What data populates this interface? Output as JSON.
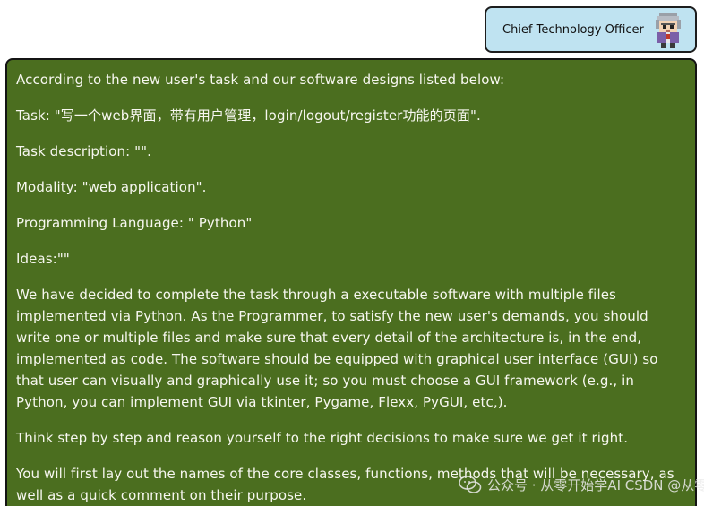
{
  "role": {
    "name": "Chief Technology Officer",
    "avatar_icon": "pixel-robot-avatar-icon"
  },
  "message": {
    "paragraphs": [
      "According to the new user's task and our software designs listed below:",
      "Task: \"写一个web界面，带有用户管理，login/logout/register功能的页面\".",
      "Task description: \"\".",
      "Modality: \"web application\".",
      "Programming Language: \" Python\"",
      "Ideas:\"\"",
      "We have decided to complete the task through a executable software with multiple files implemented via Python. As the Programmer, to satisfy the new user's demands, you should write one or multiple files and make sure that every detail of the architecture is, in the end, implemented as code. The software should be equipped with graphical user interface (GUI) so that user can visually and graphically use it; so you must choose a GUI framework (e.g., in Python, you can implement GUI via tkinter, Pygame, Flexx, PyGUI, etc,).",
      "Think step by step and reason yourself to the right decisions to make sure we get it right.",
      "You will first lay out the names of the core classes, functions, methods that will be necessary, as well as a quick comment on their purpose."
    ]
  },
  "watermark": {
    "text": "公众号 · 从零开始学AI  CSDN @从零开始学AI",
    "logo_icon": "wechat-logo-icon"
  },
  "colors": {
    "bubble_bg": "#4b6e1f",
    "badge_bg": "#bfe3f1",
    "text": "#f7f7f0"
  }
}
